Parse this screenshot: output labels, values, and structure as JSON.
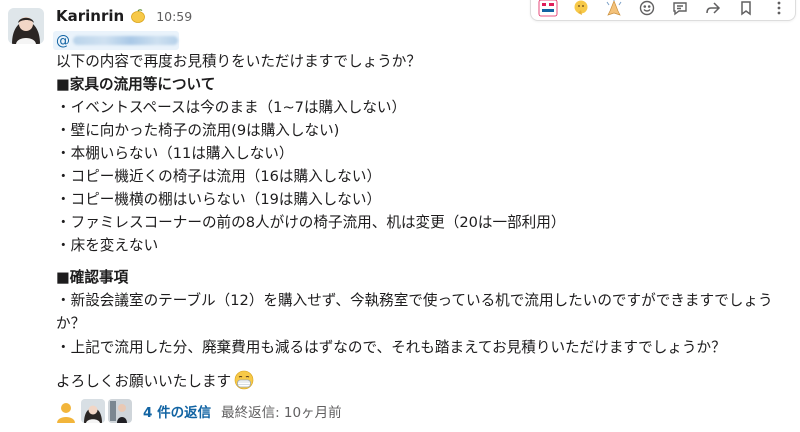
{
  "message": {
    "author": "Karinrin",
    "author_emoji": "lemon-emoji",
    "time": "10:59",
    "mention_prefix": "@",
    "lines": [
      "以下の内容で再度お見積りをいただけますでしょうか？",
      "■家具の流用等について",
      "・イベントスペースは今のまま（1~7は購入しない）",
      "・壁に向かった椅子の流用(9は購入しない)",
      "・本棚いらない（11は購入しない）",
      "・コピー機近くの椅子は流用（16は購入しない）",
      "・コピー機横の棚はいらない（19は購入しない）",
      "・ファミレスコーナーの前の8人がけの椅子流用、机は変更（20は一部利用）",
      "・床を変えない",
      "■確認事項",
      "・新設会議室のテーブル（12）を購入せず、今執務室で使っている机で流用したいのですができますでしょう",
      "か？",
      "・上記で流用した分、廃棄費用も減るはずなので、それも踏まえてお見積りいただけますでしょうか？",
      "よろしくお願いいたします"
    ],
    "closing_emoji": "face-with-mask-emoji"
  },
  "thread": {
    "reply_count": "4 件の返信",
    "last_reply": "最終返信: 10ヶ月前"
  },
  "toolbar": {
    "icons": [
      "otsukaresama-stamp-icon",
      "thinking-emoji-icon",
      "pray-emoji-icon",
      "add-reaction-icon",
      "reply-in-thread-icon",
      "share-icon",
      "bookmark-icon",
      "more-actions-icon"
    ],
    "stamp_text": "おつかれさまです"
  }
}
